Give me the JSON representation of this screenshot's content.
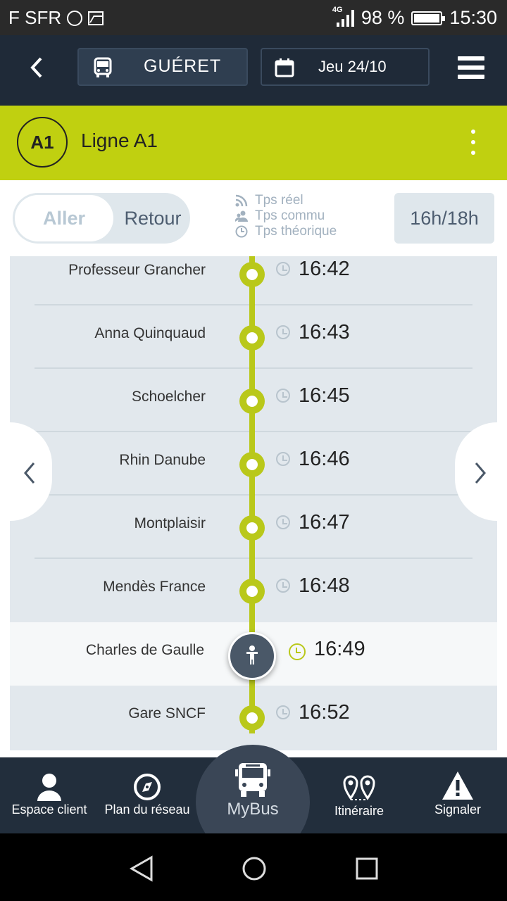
{
  "status_bar": {
    "carrier": "F SFR",
    "network": "4G",
    "battery": "98 %",
    "time": "15:30"
  },
  "header": {
    "city": "GUÉRET",
    "date": "Jeu 24/10"
  },
  "line": {
    "code": "A1",
    "name": "Ligne A1",
    "color": "#c0d010"
  },
  "direction": {
    "active": "Aller",
    "inactive": "Retour"
  },
  "legend": {
    "realtime": "Tps réel",
    "community": "Tps commu",
    "theoretical": "Tps théorique"
  },
  "hours_range": "16h/18h",
  "stops": [
    {
      "name": "Professeur Grancher",
      "time": "16:42"
    },
    {
      "name": "Anna Quinquaud",
      "time": "16:43"
    },
    {
      "name": "Schoelcher",
      "time": "16:45"
    },
    {
      "name": "Rhin Danube",
      "time": "16:46"
    },
    {
      "name": "Montplaisir",
      "time": "16:47"
    },
    {
      "name": "Mendès France",
      "time": "16:48"
    },
    {
      "name": "Charles de Gaulle",
      "time": "16:49",
      "current": true
    },
    {
      "name": "Gare SNCF",
      "time": "16:52"
    }
  ],
  "bottom_nav": {
    "account": "Espace client",
    "network_map": "Plan du réseau",
    "mybus": "MyBus",
    "itinerary": "Itinéraire",
    "report": "Signaler"
  },
  "icons": {
    "back": "chevron-left-icon",
    "bus": "bus-icon",
    "calendar": "calendar-icon",
    "menu": "hamburger-menu-icon",
    "more": "more-vertical-icon"
  }
}
